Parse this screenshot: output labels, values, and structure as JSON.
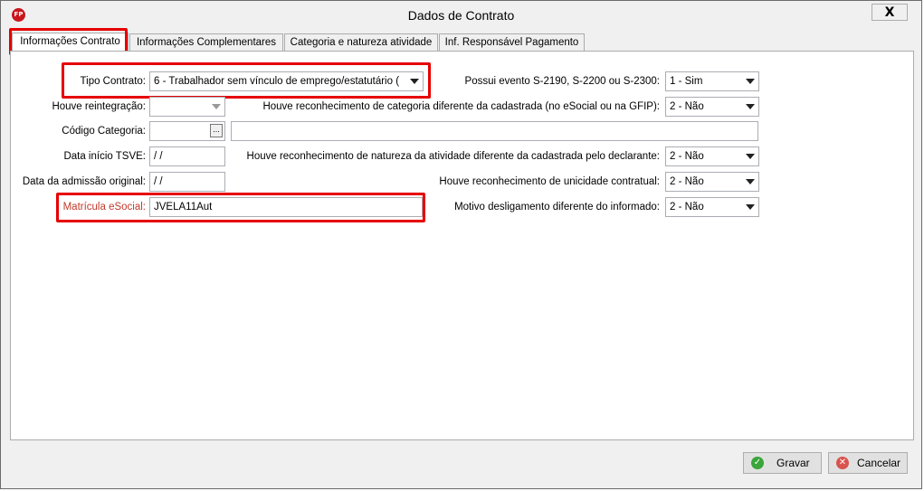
{
  "window": {
    "title": "Dados de Contrato",
    "close_label": "X",
    "app_icon_text": "FP"
  },
  "tabs": [
    {
      "label": "Informações Contrato"
    },
    {
      "label": "Informações Complementares"
    },
    {
      "label": "Categoria e natureza atividade"
    },
    {
      "label": "Inf. Responsável Pagamento"
    }
  ],
  "left": {
    "tipo_contrato_label": "Tipo Contrato:",
    "tipo_contrato_value": "6 - Trabalhador sem vínculo de emprego/estatutário (",
    "houve_reintegracao_label": "Houve reintegração:",
    "houve_reintegracao_value": "",
    "codigo_categoria_label": "Código Categoria:",
    "codigo_categoria_value": "",
    "codigo_categoria_btn": "...",
    "categoria_desc_value": "",
    "data_inicio_tsve_label": "Data início TSVE:",
    "data_inicio_tsve_value": " /  /",
    "data_admissao_label": "Data da admissão original:",
    "data_admissao_value": " /  /",
    "matricula_label": "Matrícula eSocial:",
    "matricula_value": "JVELA11Aut"
  },
  "right": {
    "evento_label": "Possui evento S-2190, S-2200 ou S-2300:",
    "evento_value": "1 - Sim",
    "reconh_categoria_label": "Houve reconhecimento de categoria diferente da cadastrada (no eSocial ou na GFIP):",
    "reconh_categoria_value": "2 - Não",
    "reconh_natureza_label": "Houve reconhecimento de natureza da atividade diferente da cadastrada pelo declarante:",
    "reconh_natureza_value": "2 - Não",
    "reconh_unicidade_label": "Houve reconhecimento de unicidade contratual:",
    "reconh_unicidade_value": "2 - Não",
    "motivo_deslig_label": "Motivo desligamento diferente do informado:",
    "motivo_deslig_value": "2 - Não"
  },
  "footer": {
    "gravar_label": "Gravar",
    "cancelar_label": "Cancelar"
  },
  "colors": {
    "highlight": "#e60000",
    "required_label": "#c0392b"
  }
}
